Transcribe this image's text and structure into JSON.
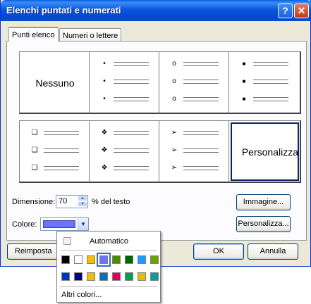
{
  "window": {
    "title": "Elenchi puntati e numerati"
  },
  "titlebar": {
    "help_label": "?",
    "close_label": "✕"
  },
  "tabs": [
    {
      "label": "Punti elenco",
      "active": true
    },
    {
      "label": "Numeri o lettere",
      "active": false
    }
  ],
  "bullets": {
    "none_label": "Nessuno",
    "custom_label": "Personalizza",
    "small_dot": "•",
    "hollow_circle": "o",
    "small_square": "■",
    "hollow_square": "❑",
    "diamond_cluster": "❖",
    "arrowhead": "➢"
  },
  "size": {
    "label": "Dimensione:",
    "value": "70",
    "suffix": "% del testo",
    "up_glyph": "▲",
    "down_glyph": "▼"
  },
  "color": {
    "label": "Colore:",
    "selected": "#6b73fa",
    "arrow_glyph": "▼"
  },
  "buttons": {
    "image_label": "Immagine...",
    "customize_label": "Personalizza...",
    "reset_label": "Reimposta",
    "ok_label": "OK",
    "cancel_label": "Annulla"
  },
  "color_menu": {
    "automatic_label": "Automatico",
    "more_label": "Altri colori...",
    "row1": [
      "#000000",
      "#ffffff",
      "#f0c000",
      "#6b73fa",
      "#4a8c00",
      "#006400",
      "#1e9bff",
      "#6ba000"
    ],
    "row2": [
      "#0033cc",
      "#000080",
      "#f0c000",
      "#0070c0",
      "#e0005a",
      "#00a050",
      "#e0c000",
      "#00a0a0"
    ]
  }
}
